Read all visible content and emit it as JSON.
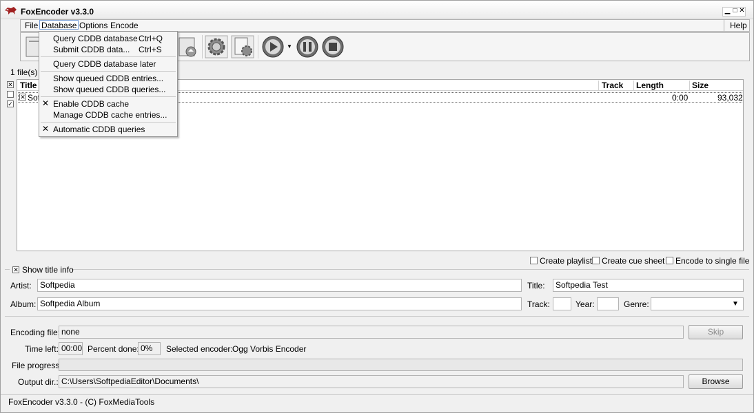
{
  "window": {
    "title": "FoxEncoder v3.3.0"
  },
  "menubar": {
    "items": [
      "File",
      "Database",
      "Options",
      "Encode"
    ],
    "help": "Help"
  },
  "list": {
    "files_count_text": "1 file(s) in",
    "columns": {
      "title": "Title",
      "track": "Track",
      "length": "Length",
      "size": "Size"
    },
    "rows": [
      {
        "title": "Sof",
        "length": "0:00",
        "size": "93,032"
      }
    ]
  },
  "options": {
    "create_playlist": "Create playlist",
    "create_cue_sheet": "Create cue sheet",
    "encode_single": "Encode to single file"
  },
  "title_info": {
    "toggle_label": "Show title info",
    "artist_label": "Artist:",
    "artist_value": "Softpedia",
    "title_label": "Title:",
    "title_value": "Softpedia Test",
    "album_label": "Album:",
    "album_value": "Softpedia Album",
    "track_label": "Track:",
    "year_label": "Year:",
    "genre_label": "Genre:"
  },
  "encoding": {
    "file_label": "Encoding file:",
    "file_value": "none",
    "skip_button": "Skip",
    "time_left_label": "Time left:",
    "time_left_value": "00:00",
    "percent_label": "Percent done:",
    "percent_value": "0%",
    "encoder_label": "Selected encoder:",
    "encoder_value": "Ogg Vorbis Encoder",
    "progress_label": "File progress:",
    "progress_fraction": 0,
    "output_label": "Output dir.:",
    "output_value": "C:\\Users\\SoftpediaEditor\\Documents\\",
    "browse_button": "Browse"
  },
  "status": {
    "text": "FoxEncoder v3.3.0 - (C) FoxMediaTools"
  },
  "database_menu": {
    "query": "Query CDDB database",
    "query_shortcut": "Ctrl+Q",
    "submit": "Submit CDDB data...",
    "submit_shortcut": "Ctrl+S",
    "query_later": "Query CDDB database later",
    "show_entries": "Show queued CDDB entries...",
    "show_queries": "Show queued CDDB queries...",
    "enable_cache": "Enable CDDB cache",
    "manage_cache": "Manage CDDB cache entries...",
    "auto_queries": "Automatic CDDB queries"
  },
  "colors": {
    "accent": "#7a9fd6",
    "background": "#f0f0f0"
  }
}
